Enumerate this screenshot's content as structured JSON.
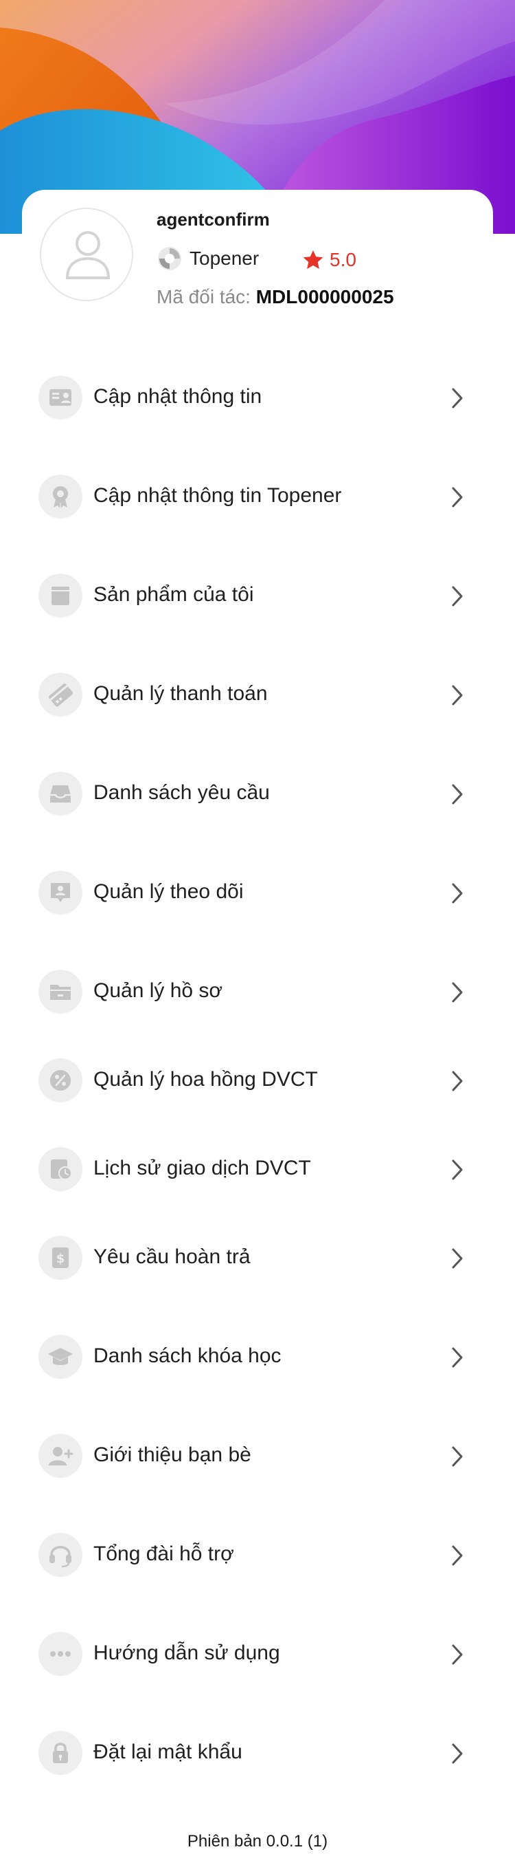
{
  "profile": {
    "username": "agentconfirm",
    "brand": "Topener",
    "rating": "5.0",
    "partner_label": "Mã đối tác:",
    "partner_code": "MDL000000025"
  },
  "menu": [
    {
      "label": "Cập nhật thông tin",
      "icon": "profile-card-icon"
    },
    {
      "label": "Cập nhật thông tin Topener",
      "icon": "award-badge-icon"
    },
    {
      "label": "Sản phẩm của tôi",
      "icon": "box-icon"
    },
    {
      "label": "Quản lý thanh toán",
      "icon": "payment-card-icon"
    },
    {
      "label": "Danh sách yêu cầu",
      "icon": "inbox-tray-icon"
    },
    {
      "label": "Quản lý theo dõi",
      "icon": "person-follow-icon"
    },
    {
      "label": "Quản lý hồ sơ",
      "icon": "folder-icon"
    },
    {
      "label": "Quản lý hoa hồng DVCT",
      "icon": "percent-icon"
    },
    {
      "label": "Lịch sử giao dịch DVCT",
      "icon": "transaction-history-icon"
    },
    {
      "label": "Yêu cầu hoàn trả",
      "icon": "refund-icon"
    },
    {
      "label": "Danh sách khóa học",
      "icon": "graduation-cap-icon"
    },
    {
      "label": "Giới thiệu bạn bè",
      "icon": "add-friend-icon"
    },
    {
      "label": "Tổng đài hỗ trợ",
      "icon": "headset-icon"
    },
    {
      "label": "Hướng dẫn sử dụng",
      "icon": "more-dots-icon"
    },
    {
      "label": "Đặt lại mật khẩu",
      "icon": "lock-icon"
    }
  ],
  "version": "Phiên bản 0.0.1 (1)",
  "colors": {
    "accent_red": "#e5332a",
    "icon_bg": "#eeeeee",
    "icon_fg": "#c4c4c4"
  }
}
